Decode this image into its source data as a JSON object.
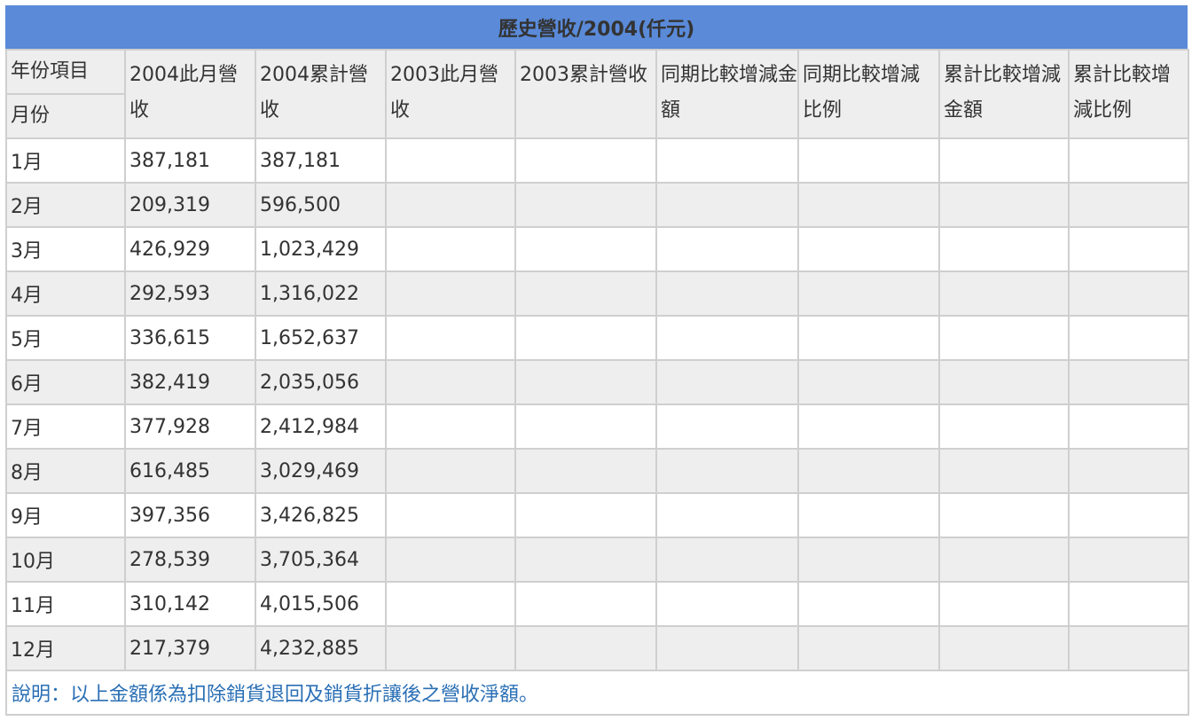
{
  "title": "歷史營收/2004(仟元)",
  "header": {
    "corner_top": "年份項目",
    "corner_bottom": "月份",
    "columns": [
      "2004此月營收",
      "2004累計營收",
      "2003此月營收",
      "2003累計營收",
      "同期比較增減金額",
      "同期比較增減比例",
      "累計比較增減金額",
      "累計比較增減比例"
    ]
  },
  "rows": [
    {
      "month": "1月",
      "rev_2004": "387,181",
      "cum_2004": "387,181",
      "rev_2003": "",
      "cum_2003": "",
      "yoy_amount": "",
      "yoy_ratio": "",
      "cum_amount": "",
      "cum_ratio": ""
    },
    {
      "month": "2月",
      "rev_2004": "209,319",
      "cum_2004": "596,500",
      "rev_2003": "",
      "cum_2003": "",
      "yoy_amount": "",
      "yoy_ratio": "",
      "cum_amount": "",
      "cum_ratio": ""
    },
    {
      "month": "3月",
      "rev_2004": "426,929",
      "cum_2004": "1,023,429",
      "rev_2003": "",
      "cum_2003": "",
      "yoy_amount": "",
      "yoy_ratio": "",
      "cum_amount": "",
      "cum_ratio": ""
    },
    {
      "month": "4月",
      "rev_2004": "292,593",
      "cum_2004": "1,316,022",
      "rev_2003": "",
      "cum_2003": "",
      "yoy_amount": "",
      "yoy_ratio": "",
      "cum_amount": "",
      "cum_ratio": ""
    },
    {
      "month": "5月",
      "rev_2004": "336,615",
      "cum_2004": "1,652,637",
      "rev_2003": "",
      "cum_2003": "",
      "yoy_amount": "",
      "yoy_ratio": "",
      "cum_amount": "",
      "cum_ratio": ""
    },
    {
      "month": "6月",
      "rev_2004": "382,419",
      "cum_2004": "2,035,056",
      "rev_2003": "",
      "cum_2003": "",
      "yoy_amount": "",
      "yoy_ratio": "",
      "cum_amount": "",
      "cum_ratio": ""
    },
    {
      "month": "7月",
      "rev_2004": "377,928",
      "cum_2004": "2,412,984",
      "rev_2003": "",
      "cum_2003": "",
      "yoy_amount": "",
      "yoy_ratio": "",
      "cum_amount": "",
      "cum_ratio": ""
    },
    {
      "month": "8月",
      "rev_2004": "616,485",
      "cum_2004": "3,029,469",
      "rev_2003": "",
      "cum_2003": "",
      "yoy_amount": "",
      "yoy_ratio": "",
      "cum_amount": "",
      "cum_ratio": ""
    },
    {
      "month": "9月",
      "rev_2004": "397,356",
      "cum_2004": "3,426,825",
      "rev_2003": "",
      "cum_2003": "",
      "yoy_amount": "",
      "yoy_ratio": "",
      "cum_amount": "",
      "cum_ratio": ""
    },
    {
      "month": "10月",
      "rev_2004": "278,539",
      "cum_2004": "3,705,364",
      "rev_2003": "",
      "cum_2003": "",
      "yoy_amount": "",
      "yoy_ratio": "",
      "cum_amount": "",
      "cum_ratio": ""
    },
    {
      "month": "11月",
      "rev_2004": "310,142",
      "cum_2004": "4,015,506",
      "rev_2003": "",
      "cum_2003": "",
      "yoy_amount": "",
      "yoy_ratio": "",
      "cum_amount": "",
      "cum_ratio": ""
    },
    {
      "month": "12月",
      "rev_2004": "217,379",
      "cum_2004": "4,232,885",
      "rev_2003": "",
      "cum_2003": "",
      "yoy_amount": "",
      "yoy_ratio": "",
      "cum_amount": "",
      "cum_ratio": ""
    }
  ],
  "footnote": "說明：以上金額係為扣除銷貨退回及銷貨折讓後之營收淨額。",
  "colors": {
    "title_bar": "#5a8ad8",
    "header_bg": "#eeeeee",
    "row_alt_bg": "#eeeeee",
    "border": "#cfcfcf",
    "footnote_text": "#2a6fb5"
  }
}
